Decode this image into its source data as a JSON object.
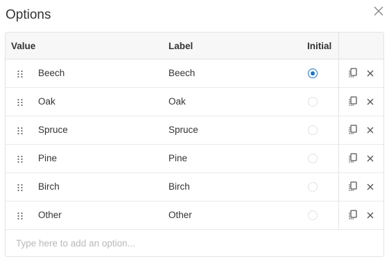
{
  "dialog": {
    "title": "Options",
    "close_icon": "close-icon"
  },
  "table": {
    "headers": {
      "value": "Value",
      "label": "Label",
      "initial": "Initial"
    },
    "rows": [
      {
        "value": "Beech",
        "label": "Beech",
        "initial": true
      },
      {
        "value": "Oak",
        "label": "Oak",
        "initial": false
      },
      {
        "value": "Spruce",
        "label": "Spruce",
        "initial": false
      },
      {
        "value": "Pine",
        "label": "Pine",
        "initial": false
      },
      {
        "value": "Birch",
        "label": "Birch",
        "initial": false
      },
      {
        "value": "Other",
        "label": "Other",
        "initial": false
      }
    ],
    "row_icons": {
      "drag": "drag-handle-icon",
      "copy": "copy-icon",
      "delete": "close-icon"
    }
  },
  "add_option": {
    "placeholder": "Type here to add an option..."
  },
  "colors": {
    "accent": "#1a73c8",
    "border": "#e3e3e3",
    "header_bg": "#f7f7f7"
  }
}
